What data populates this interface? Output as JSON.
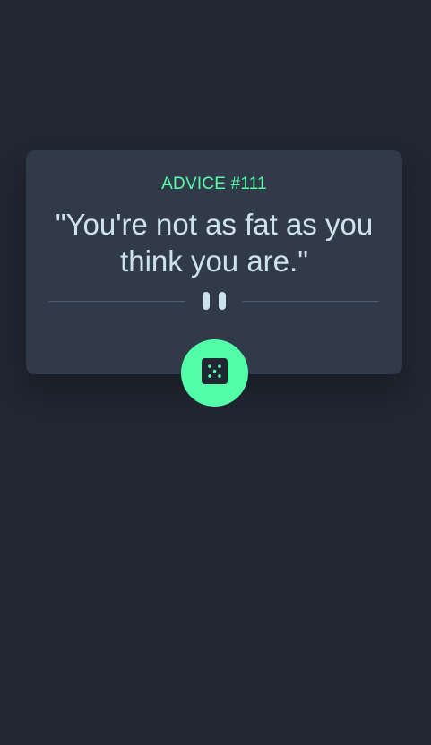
{
  "advice": {
    "label": "ADVICE #111",
    "quote": "\"You're not as fat as you think you are.\""
  },
  "icons": {
    "divider": "pause-icon",
    "button": "dice-icon"
  },
  "colors": {
    "background": "#202632",
    "card": "#313a49",
    "accent": "#52ffa8",
    "text": "#cee3e9",
    "divider": "#4f5d74"
  }
}
